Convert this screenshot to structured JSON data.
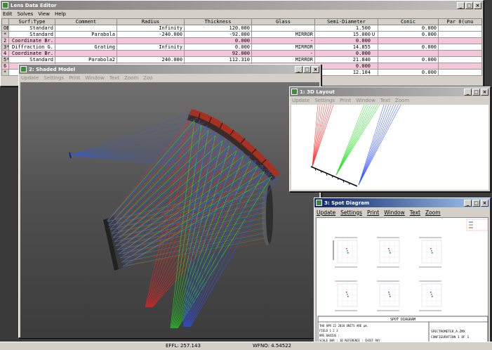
{
  "lde": {
    "title": "Lens Data Editor",
    "menu": [
      "Edit",
      "Solves",
      "View",
      "Help"
    ],
    "columns": [
      "Surf:Type",
      "Comment",
      "Radius",
      "Thickness",
      "Glass",
      "Semi-Diameter",
      "Conic",
      "Par 0(unu"
    ],
    "rows": [
      {
        "num": "OBJ",
        "type": "Standard",
        "comment": "",
        "radius": "Infinity",
        "thickness": "120.000",
        "glass": "",
        "semi": "1.500",
        "solve": "",
        "conic": "0.000",
        "pink": false
      },
      {
        "num": "*",
        "type": "Standard",
        "comment": "Parabola",
        "radius": "-240.000",
        "thickness": "-92.000",
        "glass": "MIRROR",
        "semi": "15.000",
        "solve": "U",
        "conic": "0.000",
        "pink": false
      },
      {
        "num": "2",
        "type": "Coordinate Br.",
        "comment": "",
        "radius": "",
        "thickness": "0.000",
        "glass": "-",
        "semi": "0.000",
        "solve": "",
        "conic": "",
        "pink": true
      },
      {
        "num": "3*",
        "type": "Diffraction G.",
        "comment": "Grating",
        "radius": "Infinity",
        "thickness": "0.000",
        "glass": "MIRROR",
        "semi": "14.855",
        "solve": "",
        "conic": "0.000",
        "pink": false
      },
      {
        "num": "4",
        "type": "Coordinate Br.",
        "comment": "",
        "radius": "",
        "thickness": "92.000",
        "glass": "-",
        "semi": "0.000",
        "solve": "",
        "conic": "",
        "pink": true
      },
      {
        "num": "5*",
        "type": "Standard",
        "comment": "Parabola2",
        "radius": "240.000",
        "thickness": "112.310",
        "glass": "MIRROR",
        "semi": "21.840",
        "solve": "",
        "conic": "0.000",
        "pink": false
      },
      {
        "num": "6",
        "type": "",
        "comment": "",
        "radius": "",
        "thickness": "",
        "glass": "",
        "semi": "0.000",
        "solve": "",
        "conic": "",
        "pink": true
      },
      {
        "num": "*",
        "type": "",
        "comment": "",
        "radius": "",
        "thickness": "",
        "glass": "",
        "semi": "12.104",
        "solve": "",
        "conic": "0.000",
        "pink": false
      }
    ]
  },
  "shaded": {
    "title": "2: Shaded Model",
    "menu": [
      "Update",
      "Settings",
      "Print",
      "Window",
      "Text",
      "Zoom",
      "Zoo"
    ]
  },
  "layout": {
    "title": "1: 3D Layout",
    "menu": [
      "Update",
      "Settings",
      "Print",
      "Window",
      "Text",
      "Zoom"
    ]
  },
  "spot": {
    "title": "3: Spot Diagram",
    "menu": [
      "Update",
      "Settings",
      "Print",
      "Window",
      "Text",
      "Zoom"
    ],
    "footer_title": "SPOT DIAGRAM",
    "footer_left1": "THU APR 22 2010  UNITS ARE µm.",
    "footer_left2": "FIELD      1       2       3",
    "footer_left3": "RMS RADIUS :",
    "footer_left4": "SCALE BAR  :  10  REFERENCE : CHIEF RAY",
    "footer_right1": "SPECTROMETER_A.ZMX",
    "footer_right2": "CONFIGURATION 1 OF 1"
  },
  "status": {
    "efl": "EFFL: 257.143",
    "wfno": "WFNO: 4.54522"
  },
  "colors": {
    "red": "#ff2020",
    "green": "#20e020",
    "blue": "#3050ff",
    "titlebar": "#0a246a",
    "pink_row": "#f3c6d8"
  }
}
